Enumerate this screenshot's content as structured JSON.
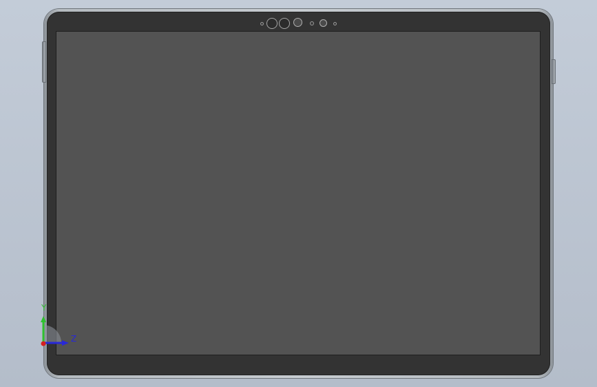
{
  "viewport": {
    "background_color": "#bcc5d1"
  },
  "device": {
    "frame_color": "#c7ccd1",
    "bezel_color": "#333333",
    "screen_color": "#535353",
    "icons": {
      "lens": "camera-lens-icon",
      "sensor": "sensor-dot-icon"
    }
  },
  "axis_triad": {
    "y_label": "Y",
    "z_label": "Z",
    "y_color": "#2fc12f",
    "z_color": "#2828d8",
    "x_color": "#d42020"
  }
}
